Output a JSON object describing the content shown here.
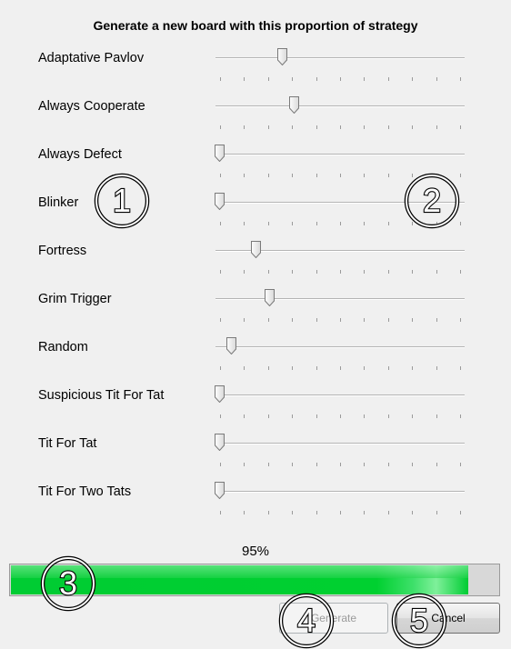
{
  "dialog": {
    "title": "Generate a new board with this proportion of strategy"
  },
  "strategies": [
    {
      "label": "Adaptative Pavlov",
      "level": 0.26
    },
    {
      "label": "Always Cooperate",
      "level": 0.31
    },
    {
      "label": "Always Defect",
      "level": 0.0
    },
    {
      "label": "Blinker",
      "level": 0.0
    },
    {
      "label": "Fortress",
      "level": 0.15
    },
    {
      "label": "Grim Trigger",
      "level": 0.21
    },
    {
      "label": "Random",
      "level": 0.05
    },
    {
      "label": "Suspicious Tit For Tat",
      "level": 0.0
    },
    {
      "label": "Tit For Tat",
      "level": 0.0
    },
    {
      "label": "Tit For Two Tats",
      "level": 0.0
    }
  ],
  "progress": {
    "label": "95%",
    "value": 0.95,
    "color": "#00cc33"
  },
  "buttons": {
    "generate": "Generate",
    "cancel": "Cancel"
  },
  "badges": [
    "1",
    "2",
    "3",
    "4",
    "5"
  ]
}
